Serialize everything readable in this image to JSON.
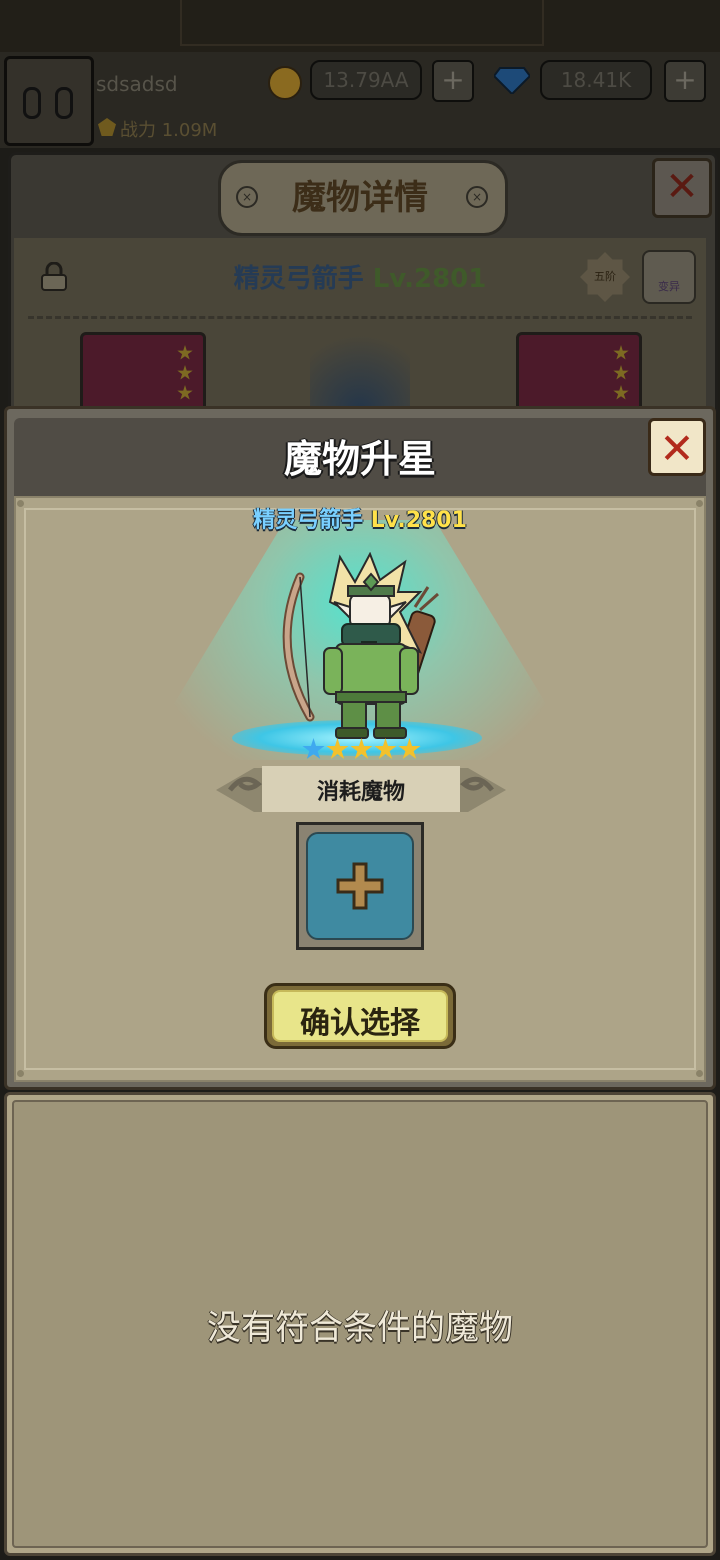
{
  "top_bar": {
    "username": "sdsadsd",
    "gold": "13.79AA",
    "gems": "18.41K",
    "power": "战力 1.09M",
    "icons": {
      "currency_add": "plus-icon",
      "gold": "coin-icon",
      "gem": "diamond-icon"
    }
  },
  "monster_detail": {
    "title": "魔物详情",
    "monster_name": "精灵弓箭手",
    "level": "Lv.2801",
    "rank_badge": "五阶",
    "mutate_label": "变异",
    "close_symbol": "✕"
  },
  "star_up_dialog": {
    "title": "魔物升星",
    "close_symbol": "✕",
    "monster_name": "精灵弓箭手",
    "level": "Lv.2801",
    "stars": [
      "blue",
      "gold",
      "gold",
      "gold",
      "gold"
    ],
    "consume_label": "消耗魔物",
    "add_slot_symbol": "+",
    "confirm_label": "确认选择"
  },
  "monster_list": {
    "empty_message": "没有符合条件的魔物"
  },
  "colors": {
    "dialog_bg": "#ada488",
    "name_blue": "#7ad0ff",
    "level_yellow": "#ffe14a",
    "slot_teal": "#3f8aa1",
    "confirm_yellow": "#e8e58a",
    "close_red": "#b22a1c"
  }
}
